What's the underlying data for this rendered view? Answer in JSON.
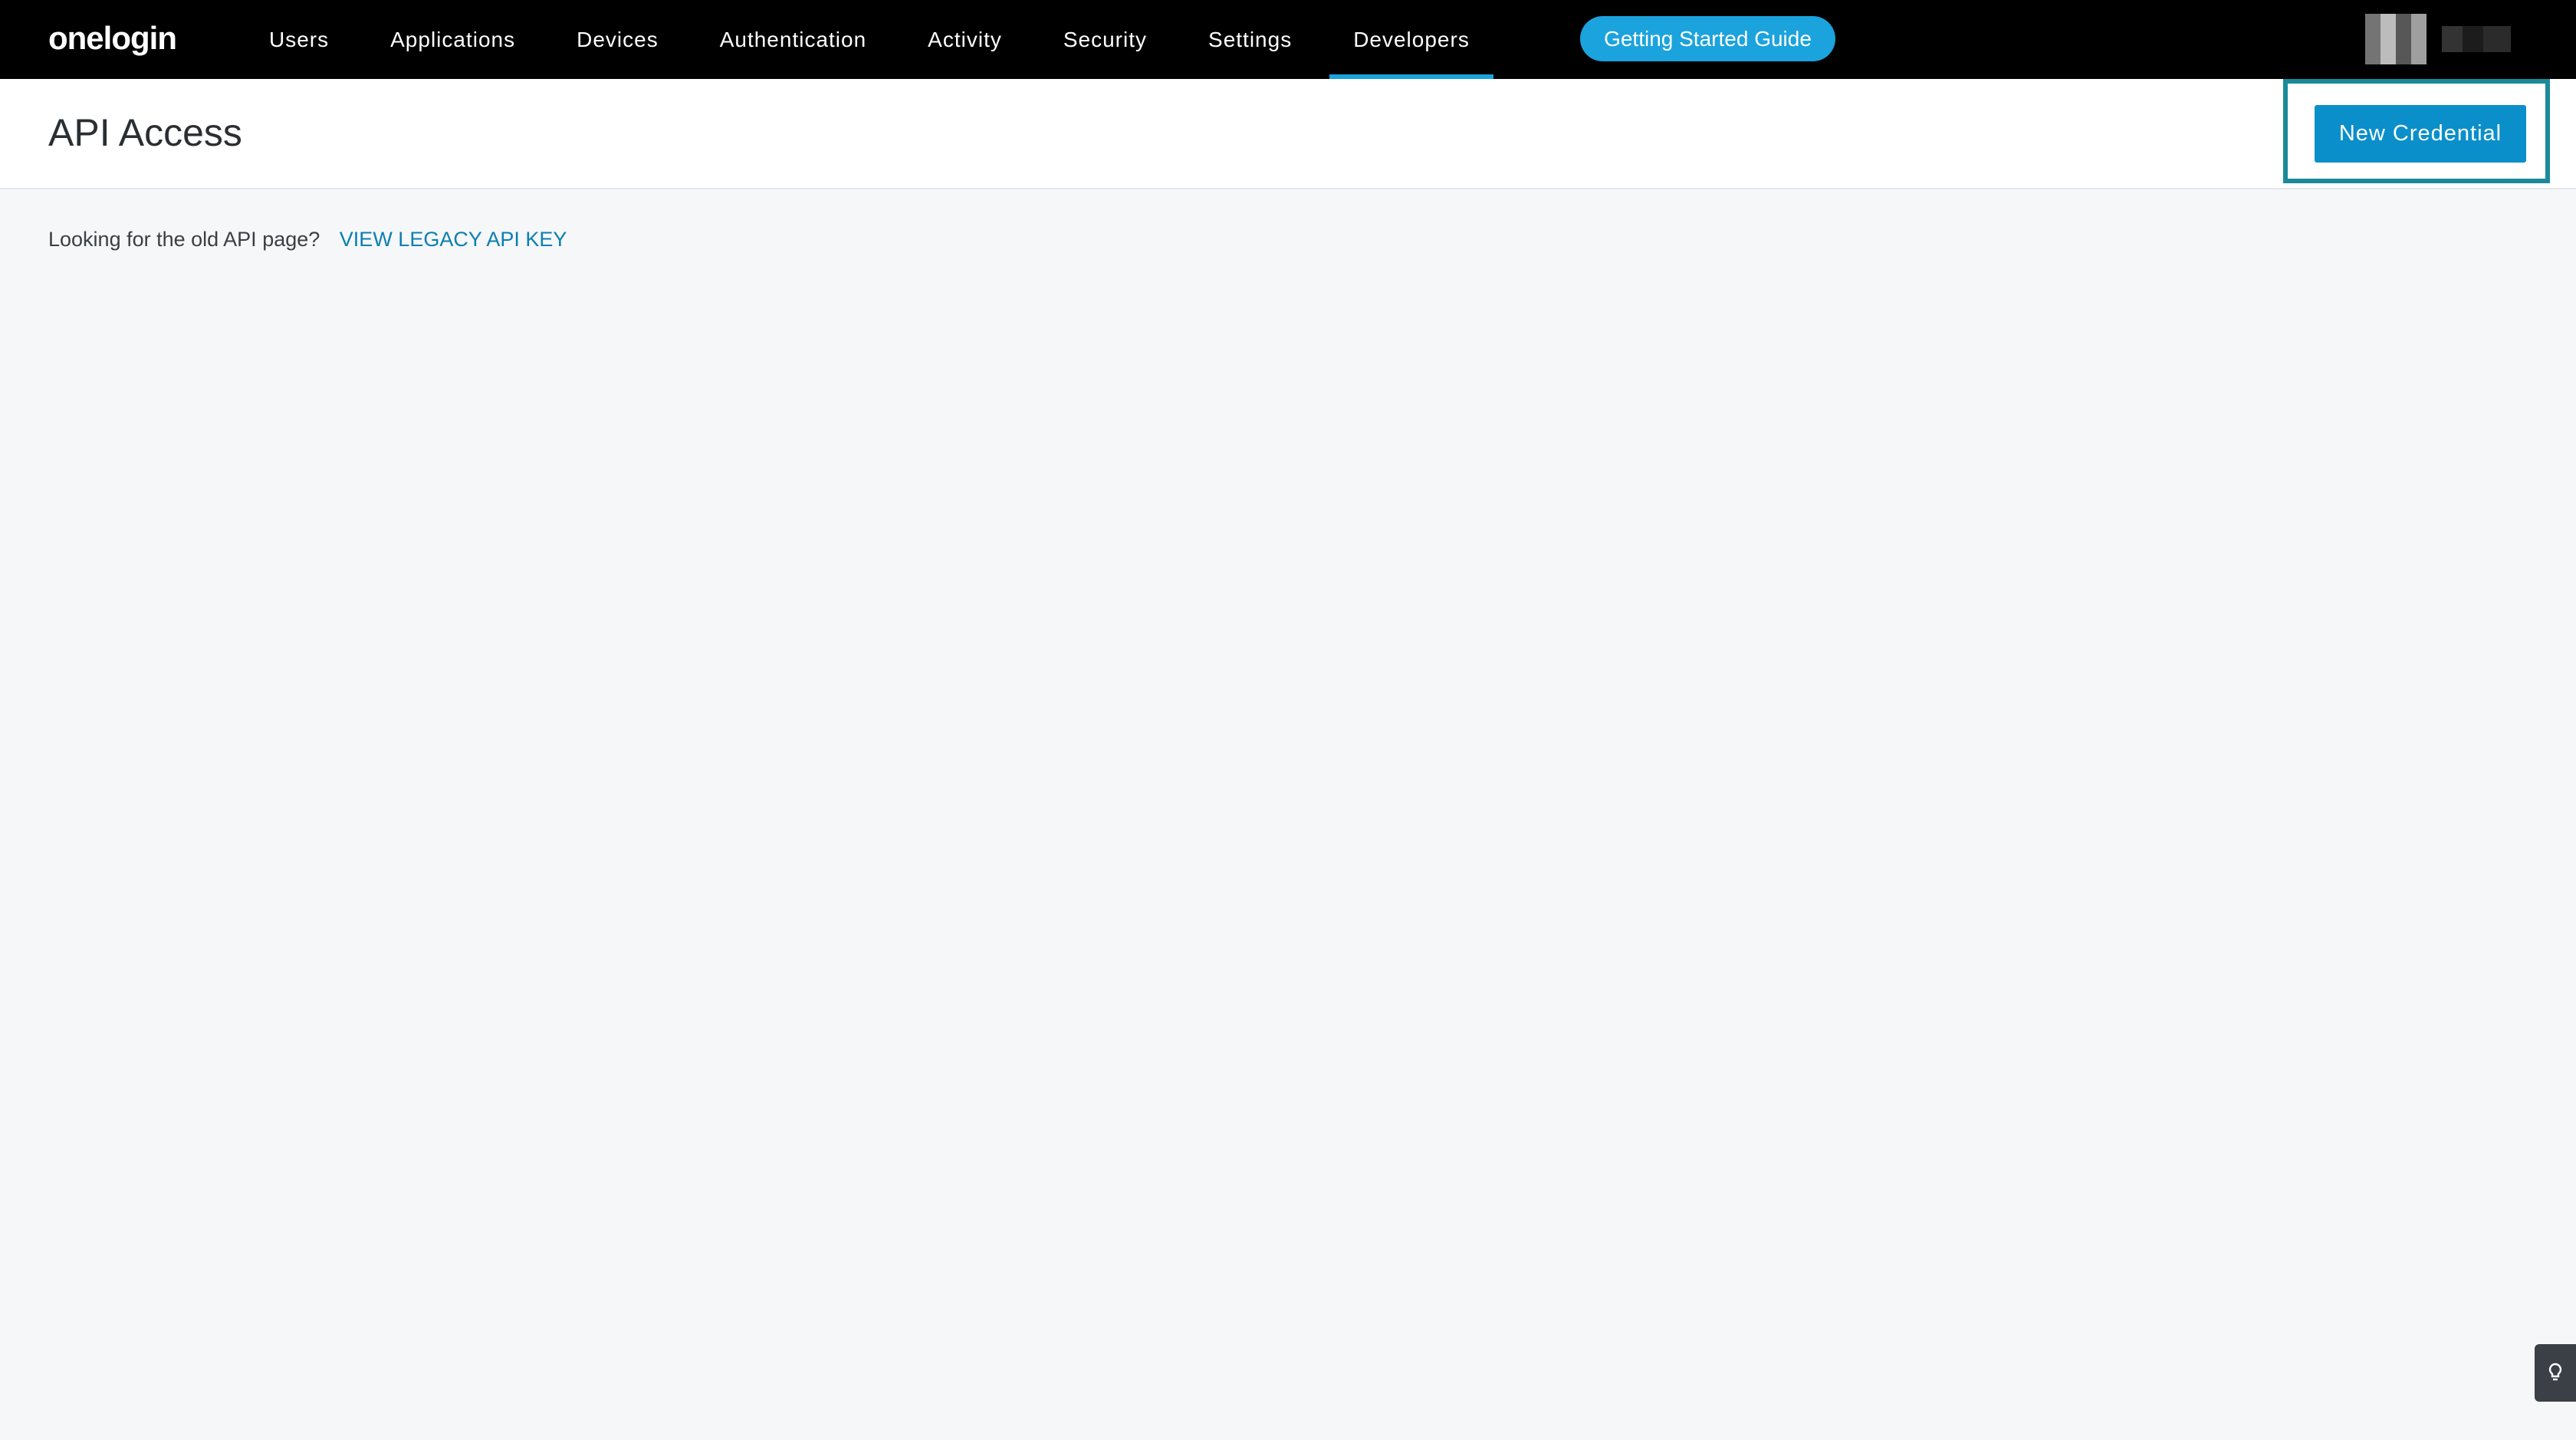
{
  "brand": {
    "logo_text": "onelogin",
    "accent": "#1ba3dd"
  },
  "nav": {
    "items": [
      {
        "label": "Users"
      },
      {
        "label": "Applications"
      },
      {
        "label": "Devices"
      },
      {
        "label": "Authentication"
      },
      {
        "label": "Activity"
      },
      {
        "label": "Security"
      },
      {
        "label": "Settings"
      },
      {
        "label": "Developers"
      }
    ],
    "active": "Developers",
    "guide_button": "Getting Started Guide"
  },
  "header": {
    "title": "API Access",
    "new_credential_button": "New Credential",
    "highlight_color": "#1a8a9a"
  },
  "main": {
    "legacy_prompt": "Looking for the old API page?",
    "legacy_link": "VIEW LEGACY API KEY"
  },
  "help_tab": {
    "icon": "lightbulb-icon"
  }
}
